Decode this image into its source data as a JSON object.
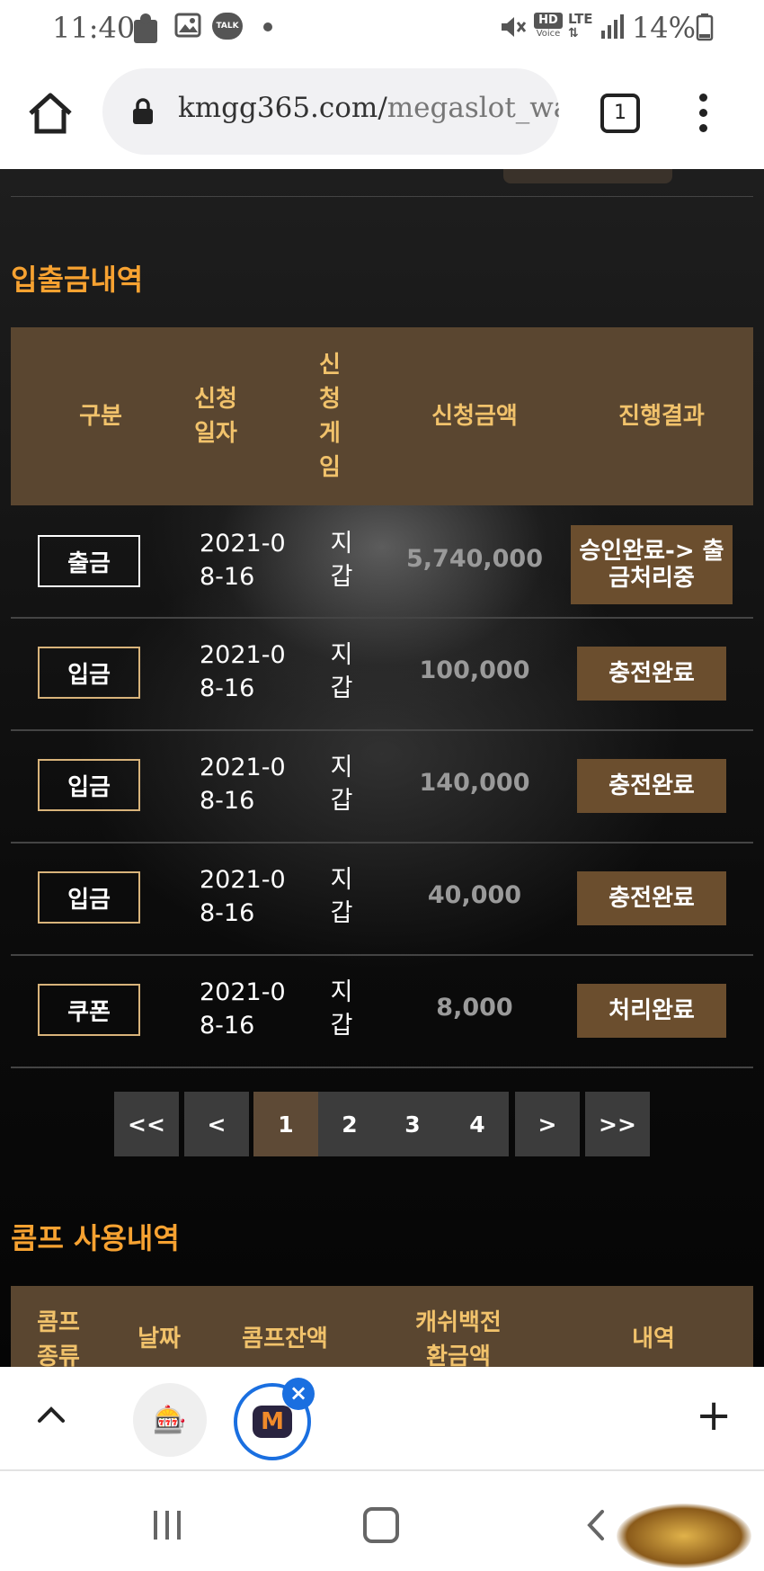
{
  "status_bar": {
    "time": "11:40",
    "battery": "14%",
    "icons": [
      "puzzle-icon",
      "gallery-icon",
      "talk-icon",
      "dot-icon",
      "mute-icon",
      "hd-voice-icon",
      "lte-icon",
      "signal-icon",
      "battery-icon"
    ],
    "talk_label": "TALK",
    "hd_label": "HD",
    "voice_label": "Voice",
    "lte_label": "LTE"
  },
  "browser": {
    "url_host": "kmgg365.com/",
    "url_path": "megaslot_wallet",
    "tab_count": "1"
  },
  "history": {
    "title": "입출금내역",
    "headers": {
      "type": "구분",
      "date": "신청일자",
      "game": "신청게임",
      "amount": "신청금액",
      "result": "진행결과"
    },
    "rows": [
      {
        "type": "출금",
        "date": "2021-08-16",
        "game": "지갑",
        "amount": "5,740,000",
        "result": "승인완료-> 출금처리중"
      },
      {
        "type": "입금",
        "date": "2021-08-16",
        "game": "지갑",
        "amount": "100,000",
        "result": "충전완료"
      },
      {
        "type": "입금",
        "date": "2021-08-16",
        "game": "지갑",
        "amount": "140,000",
        "result": "충전완료"
      },
      {
        "type": "입금",
        "date": "2021-08-16",
        "game": "지갑",
        "amount": "40,000",
        "result": "충전완료"
      },
      {
        "type": "쿠폰",
        "date": "2021-08-16",
        "game": "지갑",
        "amount": "8,000",
        "result": "처리완료"
      }
    ]
  },
  "pagination": {
    "first": "<<",
    "prev": "<",
    "pages": [
      "1",
      "2",
      "3",
      "4"
    ],
    "current": "1",
    "next": ">",
    "last": ">>"
  },
  "comp": {
    "title": "콤프 사용내역",
    "headers": {
      "type": "콤프종류",
      "date": "날짜",
      "balance": "콤프잔액",
      "cashback": "캐쉬백전환금액",
      "detail": "내역"
    }
  },
  "colors": {
    "accent_orange": "#f7a231",
    "header_brown": "#5a4630",
    "header_text": "#f1c26b",
    "button_brown": "#6b4e2e",
    "tab_blue": "#1a6fe0"
  }
}
